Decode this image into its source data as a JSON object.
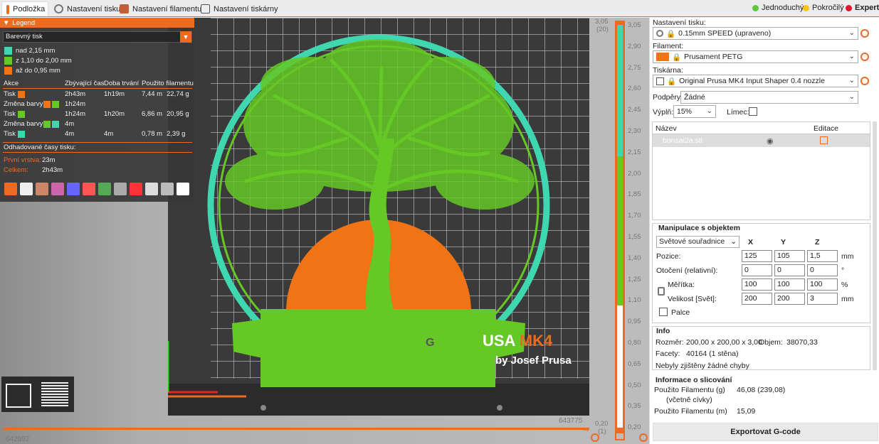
{
  "tabs": [
    {
      "label": "Podložka",
      "active": true
    },
    {
      "label": "Nastavení tisku"
    },
    {
      "label": "Nastavení filamentu"
    },
    {
      "label": "Nastavení tiskárny"
    }
  ],
  "modes": [
    {
      "label": "Jednoduchý",
      "color": "#5cc83a"
    },
    {
      "label": "Pokročilý",
      "color": "#f5c518"
    },
    {
      "label": "Expert",
      "color": "#e3162b"
    }
  ],
  "legend": {
    "title": "Legend",
    "view_type": "Barevný tisk",
    "ranges": [
      {
        "label": "nad 2,15 mm",
        "color": "#3fd7b0"
      },
      {
        "label": "z 1,10 do 2,00 mm",
        "color": "#65c825"
      },
      {
        "label": "až do 0,95 mm",
        "color": "#f07416"
      }
    ],
    "headers": [
      "Akce",
      "Zbývající čas",
      "Doba trvání",
      "Použito filamentu"
    ],
    "rows": [
      {
        "action": "Tisk",
        "c1": "#f07416",
        "c2": "",
        "remaining": "2h43m",
        "duration": "1h19m",
        "length": "7,44 m",
        "weight": "22,74 g"
      },
      {
        "action": "Změna barvy",
        "c1": "#f07416",
        "c2": "#65c825",
        "remaining": "1h24m",
        "duration": "",
        "length": "",
        "weight": ""
      },
      {
        "action": "Tisk",
        "c1": "#65c825",
        "c2": "",
        "remaining": "1h24m",
        "duration": "1h20m",
        "length": "6,86 m",
        "weight": "20,95 g"
      },
      {
        "action": "Změna barvy",
        "c1": "#65c825",
        "c2": "#3fd7b0",
        "remaining": "4m",
        "duration": "",
        "length": "",
        "weight": ""
      },
      {
        "action": "Tisk",
        "c1": "#3fd7b0",
        "c2": "",
        "remaining": "4m",
        "duration": "4m",
        "length": "0,78 m",
        "weight": "2,39 g"
      }
    ],
    "estimated_title": "Odhadované časy tisku:",
    "first_layer_label": "První vrstva:",
    "first_layer": "23m",
    "total_label": "Celkem:",
    "total": "2h43m"
  },
  "bed_text": {
    "line1": "USA ",
    "mk4": "MK4",
    "line2": "by Josef Prusa",
    "g": "G"
  },
  "vslider": {
    "top": "3,05",
    "top_layer": "(20)",
    "bottom": "0,20",
    "bottom_layer": "(1)",
    "ticks": [
      "3,05",
      "2,90",
      "2,75",
      "2,60",
      "2,45",
      "2,30",
      "2,15",
      "2,00",
      "1,85",
      "1,70",
      "1,55",
      "1,40",
      "1,25",
      "1,10",
      "0,95",
      "0,80",
      "0,65",
      "0,50",
      "0,35",
      "0,20"
    ]
  },
  "hslider": {
    "left": "642992",
    "right": "643775"
  },
  "panel": {
    "print_label": "Nastavení tisku:",
    "print_value": "0.15mm SPEED (upraveno)",
    "filament_label": "Filament:",
    "filament_value": "Prusament PETG",
    "printer_label": "Tiskárna:",
    "printer_value": "Original Prusa MK4 Input Shaper 0.4 nozzle",
    "supports_label": "Podpěry:",
    "supports_value": "Žádné",
    "infill_label": "Výplň:",
    "infill_value": "15%",
    "brim_label": "Límec:",
    "list_name": "Název",
    "list_edit": "Editace",
    "object_name": "bonsai2a.stl",
    "manip_title": "Manipulace s objektem",
    "coords": "Světové souřadnice",
    "x": "X",
    "y": "Y",
    "z": "Z",
    "pos_label": "Pozice:",
    "pos": [
      "125",
      "105",
      "1,5"
    ],
    "pos_unit": "mm",
    "rot_label": "Otočení (relativní):",
    "rot": [
      "0",
      "0",
      "0"
    ],
    "rot_unit": "°",
    "scale_label": "Měřítka:",
    "scale": [
      "100",
      "100",
      "100"
    ],
    "scale_unit": "%",
    "size_label": "Velikost [Svět]:",
    "size": [
      "200",
      "200",
      "3"
    ],
    "size_unit": "mm",
    "inches_label": "Palce",
    "info_title": "Info",
    "size_info_label": "Rozměr:",
    "size_info": "200,00 x 200,00 x 3,00",
    "volume_label": "Objem:",
    "volume": "38070,33",
    "facets_label": "Facety:",
    "facets": "40164 (1 stěna)",
    "errors": "Nebyly zjištěny žádné chyby",
    "slice_title": "Informace o slicování",
    "fil_g_label": "Použito Filamentu (g)",
    "fil_g_sub": "(včetně cívky)",
    "fil_g": "46,08 (239,08)",
    "fil_m_label": "Použito Filamentu (m)",
    "fil_m": "15,09",
    "export": "Exportovat G-code"
  }
}
